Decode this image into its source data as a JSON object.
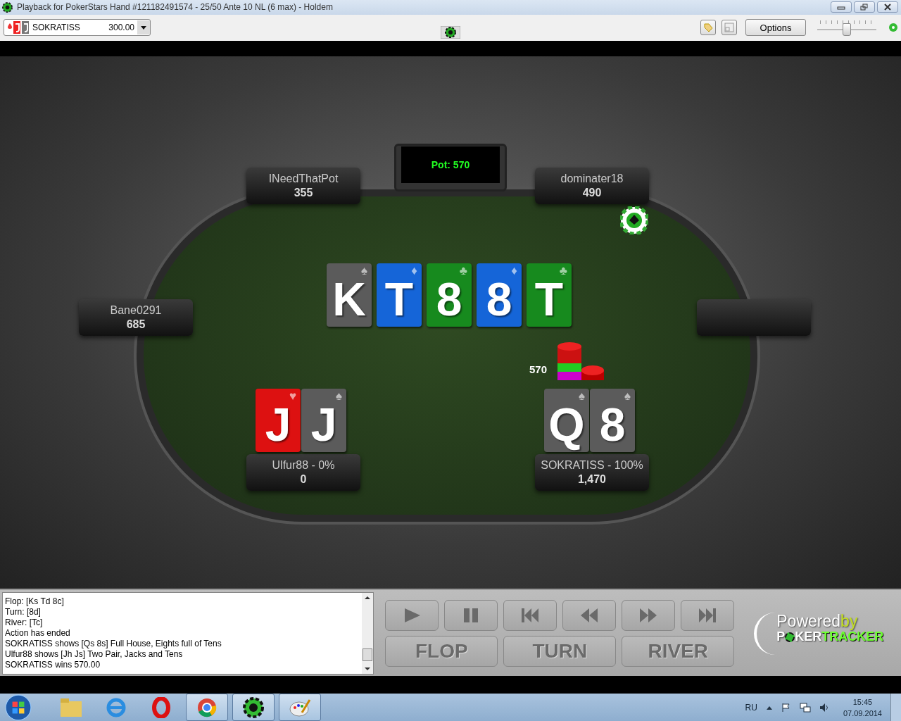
{
  "window": {
    "title": "Playback for PokerStars Hand #121182491574 - 25/50 Ante 10 NL (6 max) - Holdem"
  },
  "toolbar": {
    "player_select": {
      "value": "SOKRATISS",
      "amount": "300.00"
    },
    "options_button": "Options",
    "speed_slider": {
      "level": 0.5
    }
  },
  "table": {
    "pot": "Pot: 570",
    "board": [
      {
        "rank": "K",
        "suit": "♠",
        "color": "#5b5b5b"
      },
      {
        "rank": "T",
        "suit": "♦",
        "color": "#1565d8"
      },
      {
        "rank": "8",
        "suit": "♣",
        "color": "#178a1e"
      },
      {
        "rank": "8",
        "suit": "♦",
        "color": "#1565d8"
      },
      {
        "rank": "T",
        "suit": "♣",
        "color": "#178a1e"
      }
    ],
    "seats": [
      {
        "kind": "player",
        "name": "INeedThatPot",
        "stack": "355"
      },
      {
        "kind": "player",
        "name": "dominater18",
        "stack": "490",
        "dealer": true
      },
      {
        "kind": "player",
        "name": "Bane0291",
        "stack": "685"
      },
      {
        "kind": "empty"
      },
      {
        "kind": "player",
        "name": "Ulfur88 - 0%",
        "stack": "0",
        "cards": [
          {
            "rank": "J",
            "suit": "♥",
            "color": "#dd1111"
          },
          {
            "rank": "J",
            "suit": "♠",
            "color": "#5b5b5b"
          }
        ]
      },
      {
        "kind": "player",
        "name": "SOKRATISS - 100%",
        "stack": "1,470",
        "bet": "570",
        "cards": [
          {
            "rank": "Q",
            "suit": "♠",
            "color": "#5b5b5b"
          },
          {
            "rank": "8",
            "suit": "♠",
            "color": "#5b5b5b"
          }
        ]
      }
    ]
  },
  "log": [
    "Flop: [Ks Td 8c]",
    "Turn: [8d]",
    "River: [Tc]",
    "Action has ended",
    "SOKRATISS shows [Qs 8s] Full House, Eights full of Tens",
    "Ulfur88 shows [Jh Js] Two Pair, Jacks and Tens",
    "SOKRATISS wins 570.00"
  ],
  "street_buttons": [
    "FLOP",
    "TURN",
    "RIVER"
  ],
  "branding": {
    "line1": "Powered",
    "line1b": "by",
    "line2a": "P",
    "line2b": "KER",
    "line2c": "TRACKER"
  },
  "taskbar": {
    "language": "RU",
    "time": "15:45",
    "date": "07.09.2014"
  }
}
